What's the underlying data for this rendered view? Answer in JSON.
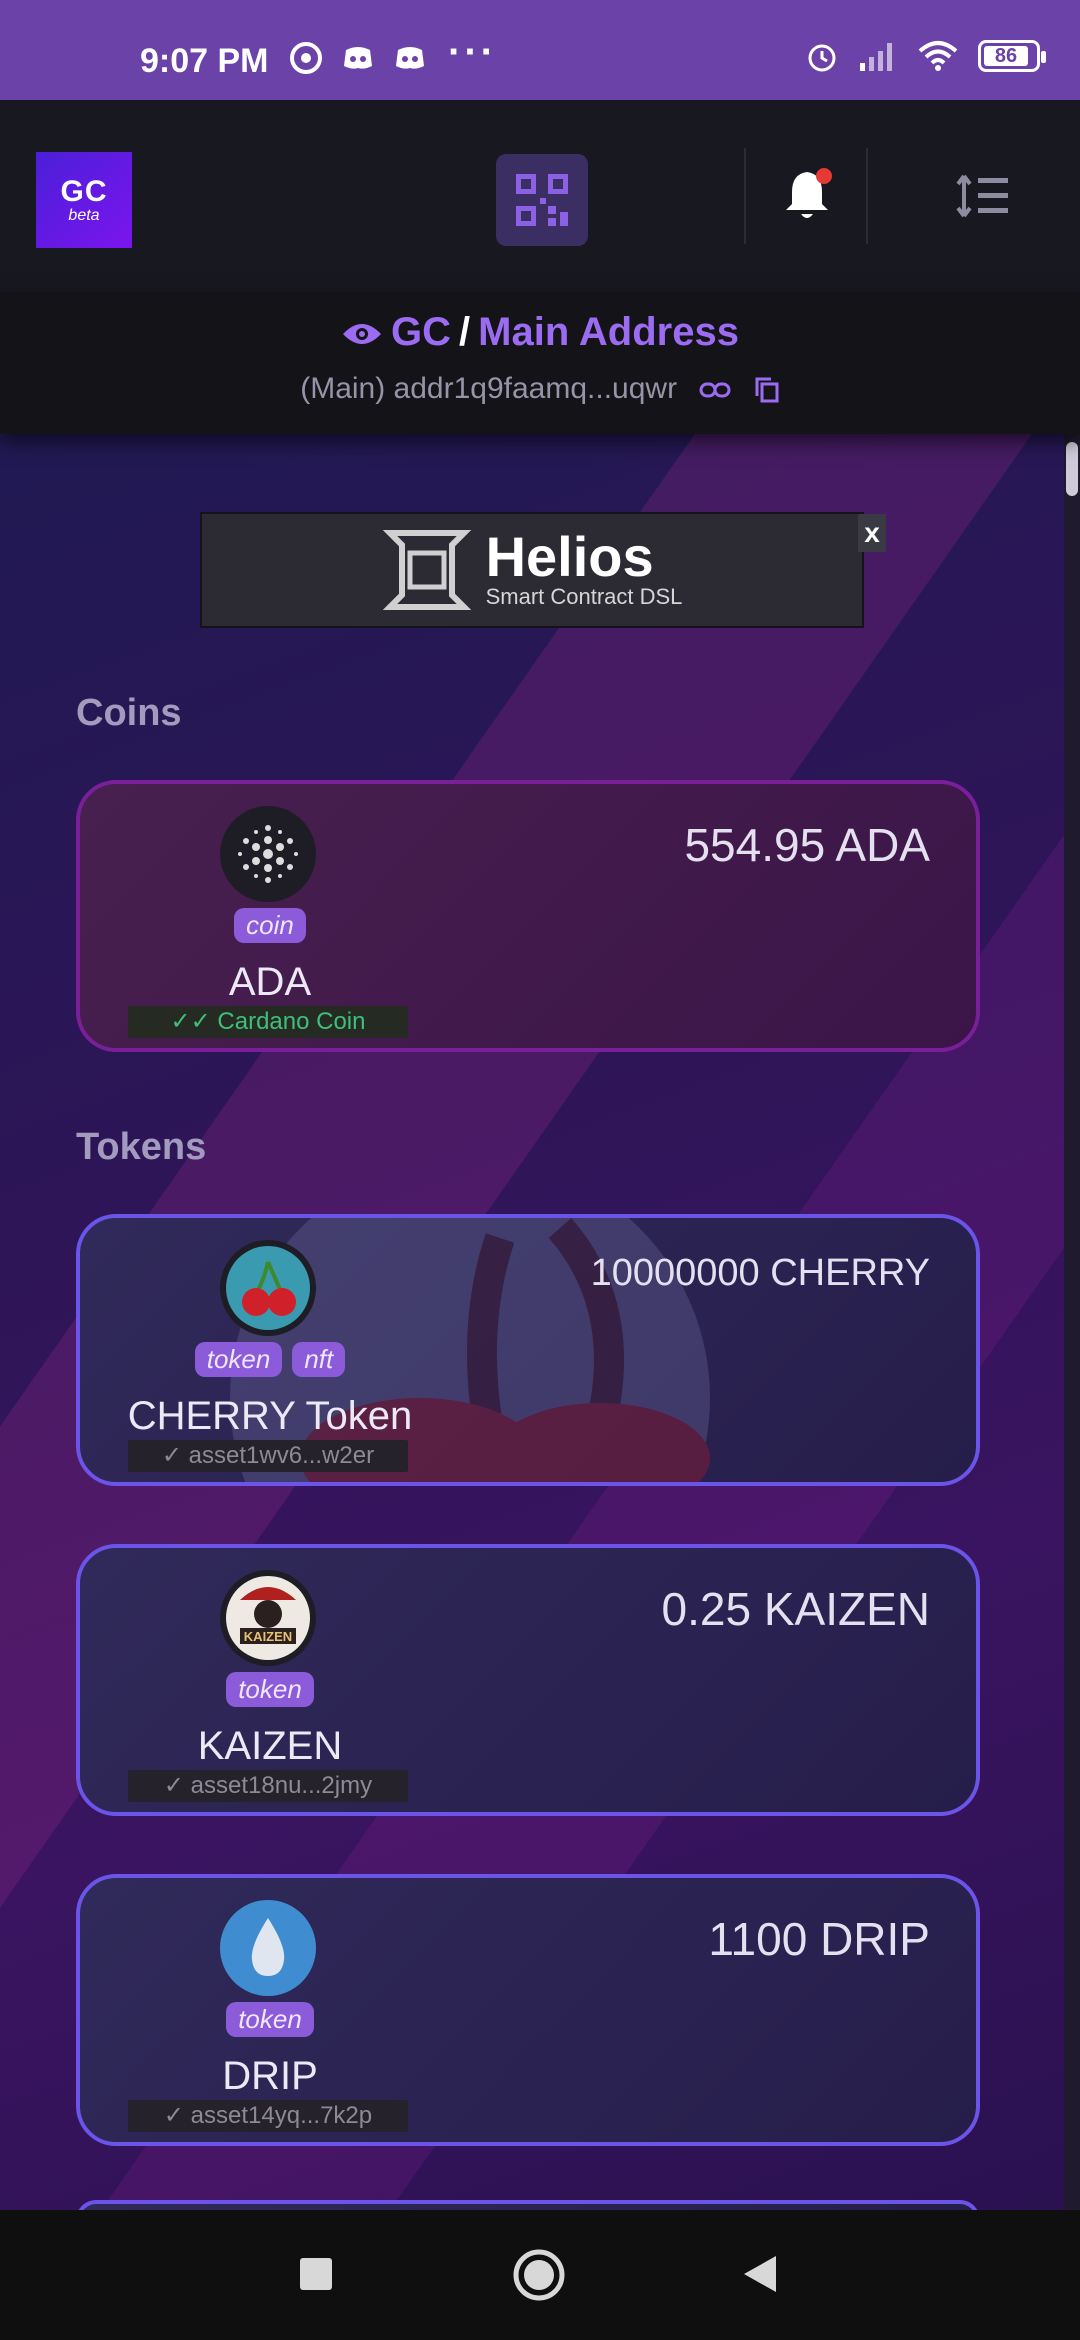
{
  "status_bar": {
    "time": "9:07 PM",
    "battery": "86",
    "icons": [
      "chrome-icon",
      "discord-icon",
      "discord-icon",
      "more-dots-icon",
      "alarm-icon",
      "signal-icon",
      "wifi-icon",
      "battery-icon"
    ]
  },
  "header": {
    "logo_text": "GC",
    "logo_sub": "beta",
    "has_notification": true
  },
  "address": {
    "crumb_root": "GC",
    "crumb_sep": "/",
    "crumb_current": "Main Address",
    "value": "(Main) addr1q9faamq...uqwr"
  },
  "ad_banner": {
    "title": "Helios",
    "subtitle": "Smart Contract DSL",
    "close_label": "x"
  },
  "coins_section": {
    "title": "Coins",
    "items": [
      {
        "name": "ADA",
        "tags": [
          "coin"
        ],
        "policy": "Cardano Coin",
        "amount": "554.95 ADA"
      }
    ]
  },
  "tokens_section": {
    "title": "Tokens",
    "items": [
      {
        "name": "CHERRY Token",
        "tags": [
          "token",
          "nft"
        ],
        "policy": "asset1wv6...w2er",
        "amount": "10000000 CHERRY"
      },
      {
        "name": "KAIZEN",
        "tags": [
          "token"
        ],
        "policy": "asset18nu...2jmy",
        "amount": "0.25 KAIZEN"
      },
      {
        "name": "DRIP",
        "tags": [
          "token"
        ],
        "policy": "asset14yq...7k2p",
        "amount": "1100 DRIP"
      }
    ]
  },
  "colors": {
    "accent": "#9b6cf2",
    "status_bar": "#6a42a8",
    "verified": "#3fbf7a",
    "notification_dot": "#e53935"
  }
}
